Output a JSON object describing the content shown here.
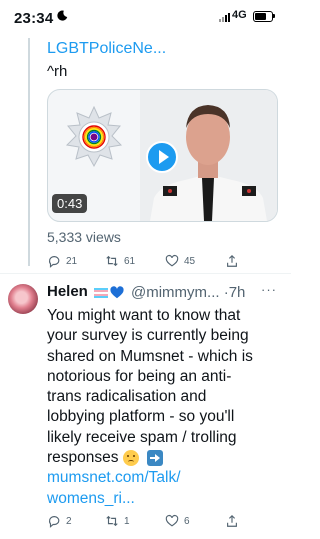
{
  "status_bar": {
    "time": "23:34",
    "network": "4G"
  },
  "tweet1": {
    "link_text": "LGBTPoliceNe...",
    "continuation": "^rh",
    "video_duration": "0:43",
    "views": "5,333 views",
    "replies": "21",
    "retweets": "61",
    "likes": "45"
  },
  "tweet2": {
    "name": "Helen",
    "handle": "@mimmym...",
    "time": "·7h",
    "more": "···",
    "body_lines": [
      "You might want to know that",
      "your survey is currently being",
      "shared on Mumsnet - which is",
      "notorious for being an anti-",
      "trans radicalisation and",
      "lobbying platform - so you'll",
      "likely receive spam / trolling",
      "responses"
    ],
    "link_lines": [
      "mumsnet.com/Talk/",
      "womens_ri..."
    ],
    "replies": "2",
    "retweets": "1",
    "likes": "6"
  },
  "colors": {
    "accent": "#1d9bf0",
    "muted": "#536471",
    "border": "#cfd9de"
  },
  "icons": [
    "moon-icon",
    "signal-icon",
    "battery-icon",
    "play-icon",
    "reply-icon",
    "retweet-icon",
    "like-icon",
    "share-icon",
    "trans-flag-emoji",
    "blue-heart-emoji",
    "sad-face-emoji",
    "right-arrow-emoji"
  ]
}
